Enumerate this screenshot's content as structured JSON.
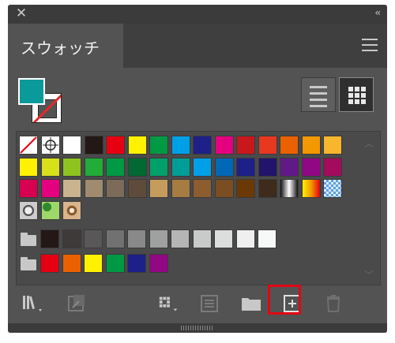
{
  "panel": {
    "tab_label": "スウォッチ",
    "collapse_glyph": "‹‹",
    "close_glyph": "✕"
  },
  "fill_color": "#0a9a9a",
  "icons": [
    "close-icon",
    "collapse-icon",
    "panel-menu-icon",
    "list-view-icon",
    "grid-view-icon",
    "library-icon",
    "place-swatch-icon",
    "swatch-kind-menu-icon",
    "swatch-options-icon",
    "folder-icon",
    "add-swatch-icon",
    "delete-icon"
  ],
  "swatch_rows": [
    [
      "none",
      "registration",
      "#ffffff",
      "#231815",
      "#e60012",
      "#fff100",
      "#009944",
      "#00a0e9",
      "#1d2088",
      "#e4007f",
      "#c9171e",
      "#e83820",
      "#eb6100",
      "#f39800",
      "#f8b62d"
    ],
    [
      "#fff100",
      "#d7e11a",
      "#8fc31f",
      "#22ac38",
      "#009944",
      "#006934",
      "#00a06b",
      "#009e96",
      "#00a0e9",
      "#0068b7",
      "#1d2088",
      "#22146b",
      "#601986",
      "#920783",
      "#a40b5d"
    ],
    [
      "#d70051",
      "#e4007f",
      "#c9b48f",
      "#a08b70",
      "#7c6b58",
      "#5e4b3c",
      "#c69c5d",
      "#a67c43",
      "#8c5d2f",
      "#7a4d22",
      "#6a3906",
      "#3e2b1c",
      "gradient-bw",
      "gradient-orange",
      "gradient-blue"
    ],
    [
      "pattern-1",
      "pattern-2",
      "pattern-3"
    ]
  ],
  "group_grays": [
    "#231815",
    "#3e3a39",
    "#595757",
    "#727171",
    "#898989",
    "#9fa0a0",
    "#b5b5b6",
    "#c9caca",
    "#dcdddd",
    "#efefef",
    "#f7f8f8"
  ],
  "group_colors": [
    "#e60012",
    "#eb6100",
    "#fff100",
    "#009944",
    "#1d2088",
    "#920783"
  ]
}
